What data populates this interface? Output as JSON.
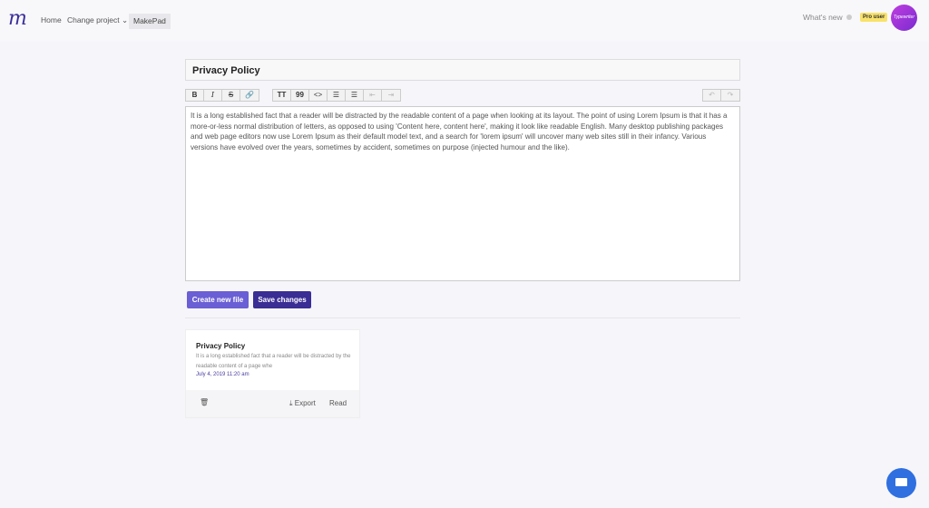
{
  "header": {
    "logo": "m",
    "nav": [
      "Home",
      "Change project",
      "MakePad"
    ],
    "whats_new": "What's new",
    "badge": "Pro user",
    "avatar_text": "Typewriter"
  },
  "document": {
    "title": "Privacy Policy",
    "body": "It is a long established fact that a reader will be distracted by the readable content of a page when looking at its layout. The point of using Lorem Ipsum is that it has a more-or-less normal distribution of letters, as opposed to using 'Content here, content here', making it look like readable English. Many desktop publishing packages and web page editors now use Lorem Ipsum as their default model text, and a search for 'lorem ipsum' will uncover many web sites still in their infancy. Various versions have evolved over the years, sometimes by accident, sometimes on purpose (injected humour and the like)."
  },
  "toolbar": {
    "bold": "B",
    "italic": "I",
    "strike": "S",
    "link": "🔗",
    "heading": "TT",
    "quote": "99",
    "code": "<>",
    "ul": "☰",
    "ol": "☰",
    "outdent": "⇤",
    "indent": "⇥",
    "undo": "↶",
    "redo": "↷"
  },
  "buttons": {
    "create": "Create new file",
    "save": "Save changes"
  },
  "card": {
    "title": "Privacy Policy",
    "excerpt": "It is a long established fact that a reader will be distracted by the readable content of a page whe",
    "date": "July 4, 2019 11:20 am",
    "delete": "🗑",
    "export": "⤓ Export",
    "read": "Read"
  },
  "colors": {
    "create": "#6a5fd4",
    "save": "#3a2d94",
    "chat": "#2f6fe0"
  }
}
